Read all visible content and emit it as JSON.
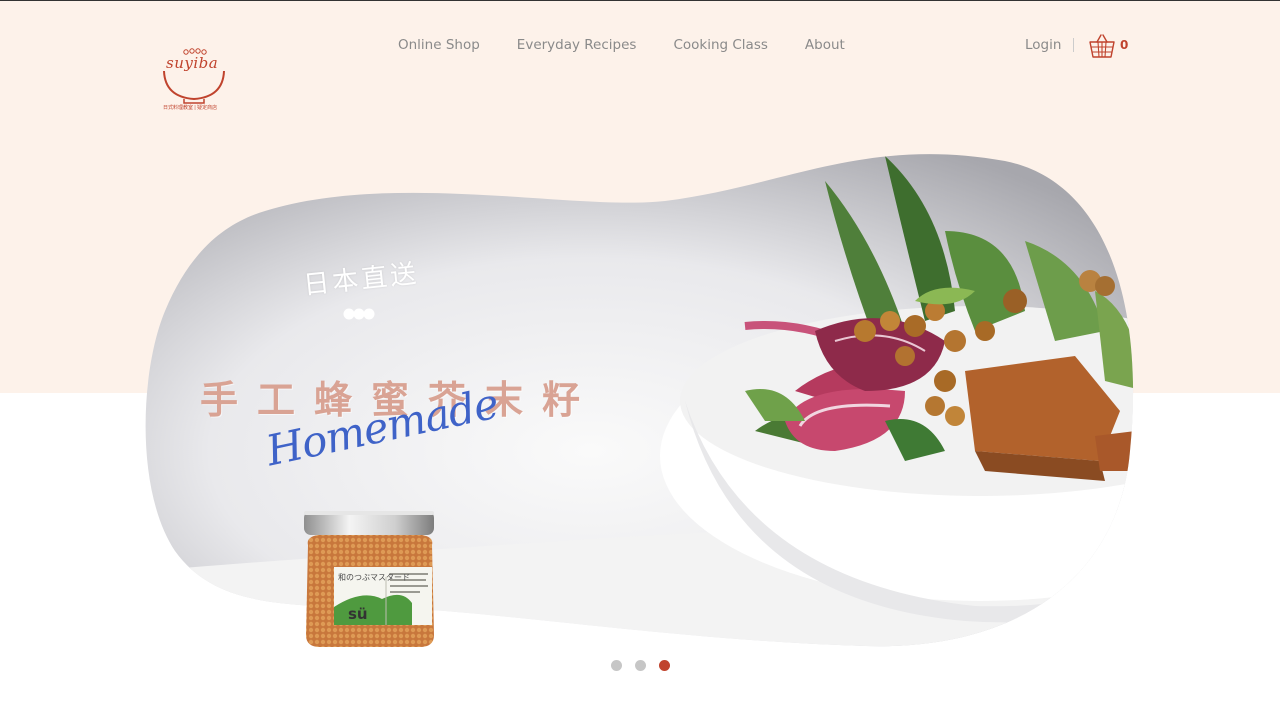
{
  "header": {
    "logo": {
      "wordmark": "suyiba",
      "tagline": "日式料理教室 | 疑定商店"
    },
    "nav": [
      "Online Shop",
      "Everyday Recipes",
      "Cooking Class",
      "About"
    ],
    "login_label": "Login",
    "cart_count": "0"
  },
  "hero": {
    "subtitle": "日本直送",
    "title": "手工蜂蜜芥末籽",
    "script": "Homemade",
    "jar_label_main": "sü",
    "jar_label_jp": "和のつぶマスタード"
  },
  "carousel": {
    "slides": 3,
    "active_index": 2
  },
  "colors": {
    "brand": "#c0432d",
    "peach_bg": "#fdf2ea",
    "nav_text": "#8a8a8a",
    "title_pink": "#d9a394",
    "script_blue": "#3f63c8",
    "dot_inactive": "#c6c6c6"
  },
  "icons": [
    "basket-cart-icon",
    "bowl-logo-icon"
  ]
}
